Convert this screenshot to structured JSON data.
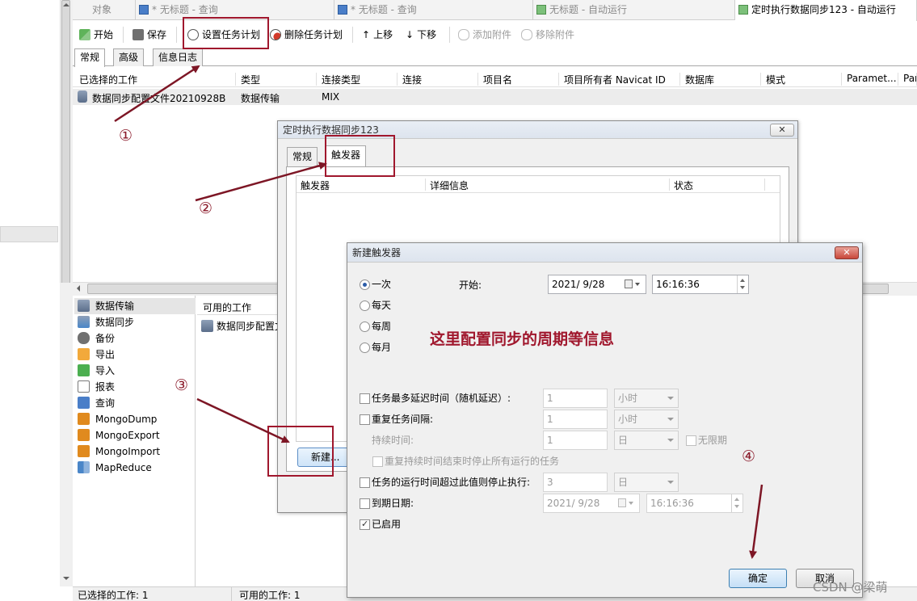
{
  "top_tabs": [
    {
      "label": "对象"
    },
    {
      "label": "* 无标题 - 查询"
    },
    {
      "label": "* 无标题 - 查询"
    },
    {
      "label": "无标题 - 自动运行"
    },
    {
      "label": "定时执行数据同步123 - 自动运行"
    }
  ],
  "toolbar": {
    "start": "开始",
    "save": "保存",
    "set_schedule": "设置任务计划",
    "delete_schedule": "删除任务计划",
    "move_up": "上移",
    "move_down": "下移",
    "add_attachment": "添加附件",
    "remove_attachment": "移除附件"
  },
  "sub_tabs": [
    "常规",
    "高级",
    "信息日志"
  ],
  "grid": {
    "columns": [
      "已选择的工作",
      "类型",
      "连接类型",
      "连接",
      "项目名",
      "项目所有者 Navicat ID",
      "数据库",
      "模式",
      "Paramet...",
      "Par"
    ],
    "rows": [
      [
        "数据同步配置文件20210928B",
        "数据传输",
        "MIX"
      ]
    ]
  },
  "job_types": [
    {
      "label": "数据传输",
      "icon": "data-transfer-icon",
      "selected": true
    },
    {
      "label": "数据同步",
      "icon": "data-sync-icon"
    },
    {
      "label": "备份",
      "icon": "backup-icon"
    },
    {
      "label": "导出",
      "icon": "export-icon"
    },
    {
      "label": "导入",
      "icon": "import-icon"
    },
    {
      "label": "报表",
      "icon": "report-icon"
    },
    {
      "label": "查询",
      "icon": "query-icon"
    },
    {
      "label": "MongoDump",
      "icon": "mongodump-icon"
    },
    {
      "label": "MongoExport",
      "icon": "mongoexport-icon"
    },
    {
      "label": "MongoImport",
      "icon": "mongoimport-icon"
    },
    {
      "label": "MapReduce",
      "icon": "mapreduce-icon"
    }
  ],
  "available_jobs": {
    "header": "可用的工作",
    "items": [
      "数据同步配置文"
    ]
  },
  "status_bar": {
    "selected": "已选择的工作: 1",
    "available": "可用的工作: 1"
  },
  "dialog_schedule": {
    "title": "定时执行数据同步123",
    "close": "✕",
    "tabs": [
      "常规",
      "触发器"
    ],
    "columns": [
      "触发器",
      "详细信息",
      "状态"
    ],
    "new_button": "新建..."
  },
  "dialog_trigger": {
    "title": "新建触发器",
    "close": "✕",
    "frequency_options": [
      {
        "label": "一次",
        "checked": true
      },
      {
        "label": "每天",
        "checked": false
      },
      {
        "label": "每周",
        "checked": false
      },
      {
        "label": "每月",
        "checked": false
      }
    ],
    "start_label": "开始:",
    "start_date": "2021/  9/28",
    "start_time": "16:16:36",
    "note": "这里配置同步的周期等信息",
    "max_delay": {
      "label": "任务最多延迟时间（随机延迟）:",
      "value": "1",
      "unit": "小时",
      "checked": false
    },
    "repeat": {
      "label": "重复任务间隔:",
      "value": "1",
      "unit": "小时",
      "checked": false
    },
    "duration": {
      "label": "持续时间:",
      "value": "1",
      "unit": "日"
    },
    "indefinitely": "无限期",
    "stop_running": "重复持续时间结束时停止所有运行的任务",
    "stop_if_exceeds": {
      "label": "任务的运行时间超过此值则停止执行:",
      "value": "3",
      "unit": "日",
      "checked": false
    },
    "expire": {
      "label": "到期日期:",
      "date": "2021/  9/28",
      "time": "16:16:36",
      "checked": false
    },
    "enabled": {
      "label": "已启用",
      "checked": true
    },
    "ok": "确定",
    "cancel": "取消"
  },
  "annotations": [
    "①",
    "②",
    "③",
    "④"
  ],
  "watermark": "CSDN @梁萌",
  "colors": {
    "annotation_red": "#a0172d",
    "arrow_red": "#7d1625",
    "selection_gray": "#e5e5e5",
    "primary_button_blue": "#c5dff6"
  }
}
